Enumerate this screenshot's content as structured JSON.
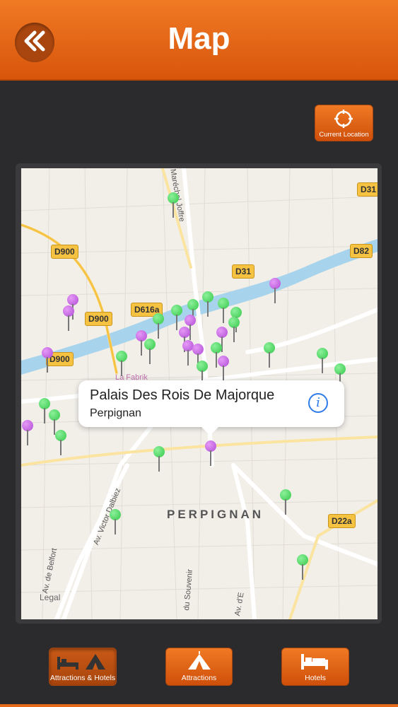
{
  "header": {
    "title": "Map",
    "back_icon": "double-chevron-left-icon"
  },
  "current_location": {
    "label": "Current Location",
    "icon": "crosshair-icon"
  },
  "map": {
    "city_label": "PERPIGNAN",
    "poi_label": "La Fabrik",
    "legal": "Legal",
    "road_badges": [
      "D31",
      "D900",
      "D82",
      "D31",
      "D616a",
      "D900",
      "D900",
      "D22a"
    ],
    "streets": [
      "Maréchal Joffre",
      "Av. Victor Dalbiez",
      "Av. de Belfort",
      "du Souvenir",
      "Av. d'E"
    ],
    "callout": {
      "title": "Palais Des Rois De Majorque",
      "subtitle": "Perpignan",
      "info_icon": "info-icon"
    }
  },
  "tabs": [
    {
      "label": "Attractions & Hotels",
      "icon": "bed-and-tent-icon",
      "active": true
    },
    {
      "label": "Attractions",
      "icon": "tent-icon",
      "active": false
    },
    {
      "label": "Hotels",
      "icon": "bed-icon",
      "active": false
    }
  ],
  "colors": {
    "accent": "#e8651a",
    "background": "#2b2b2d",
    "pin_green": "#35c84a",
    "pin_purple": "#b14bd6"
  }
}
